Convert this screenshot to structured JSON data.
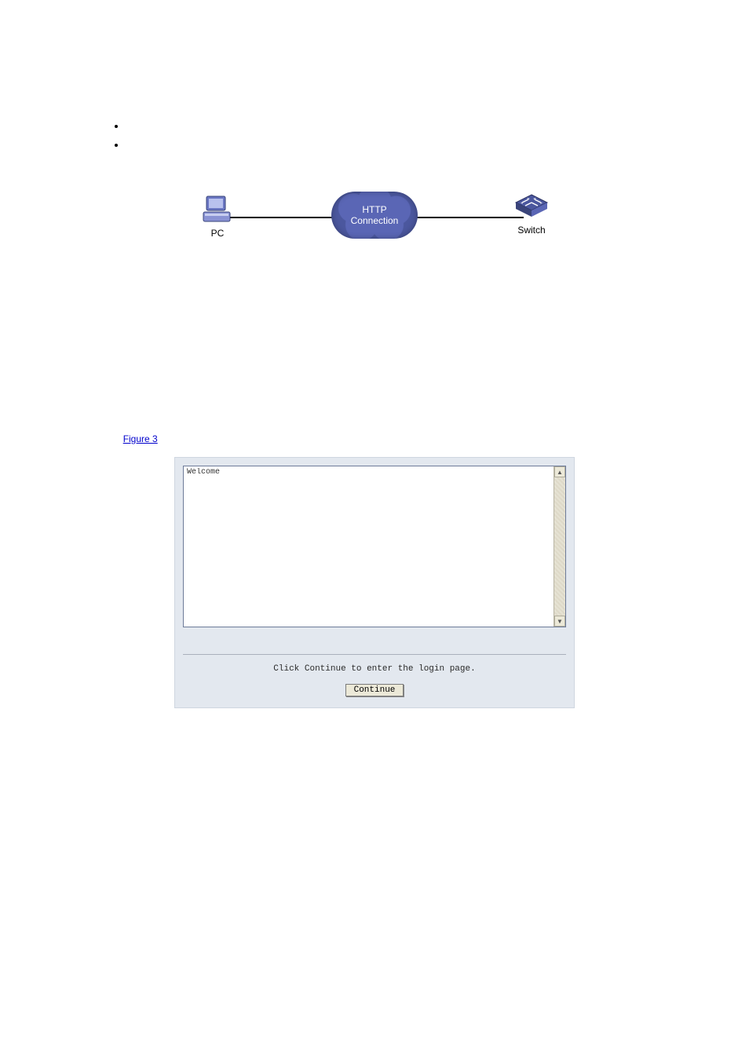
{
  "bullets": [
    "",
    ""
  ],
  "diagram": {
    "pc_label": "PC",
    "switch_label": "Switch",
    "cloud_line1": "HTTP",
    "cloud_line2": "Connection"
  },
  "figure_link_text": "Figure 3",
  "browser": {
    "textarea_text": "Welcome",
    "prompt_text": "Click Continue to enter the login page.",
    "continue_label": "Continue"
  }
}
